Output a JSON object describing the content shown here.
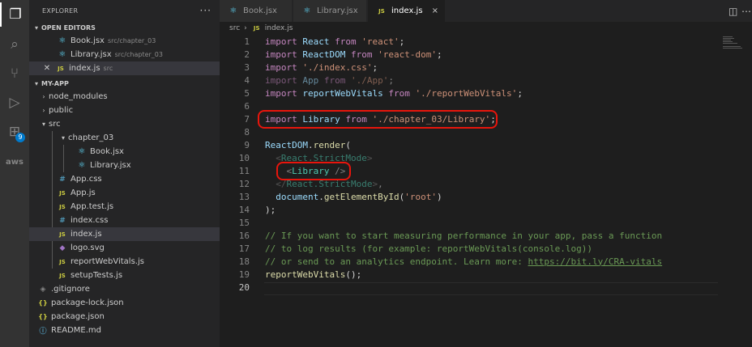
{
  "activity_bar": {
    "icons": [
      "files-icon",
      "search-icon",
      "source-control-icon",
      "run-debug-icon",
      "extensions-icon",
      "aws-icon"
    ],
    "extensions_badge": "9",
    "aws_label": "aws"
  },
  "sidebar": {
    "title": "EXPLORER",
    "more_label": "···",
    "open_editors": {
      "title": "OPEN EDITORS",
      "items": [
        {
          "name": "Book.jsx",
          "desc": "src/chapter_03"
        },
        {
          "name": "Library.jsx",
          "desc": "src/chapter_03"
        },
        {
          "name": "index.js",
          "desc": "src"
        }
      ]
    },
    "project": {
      "title": "MY-APP",
      "tree": [
        {
          "name": "node_modules"
        },
        {
          "name": "public"
        },
        {
          "name": "src"
        },
        {
          "name": "chapter_03"
        },
        {
          "name": "Book.jsx"
        },
        {
          "name": "Library.jsx"
        },
        {
          "name": "App.css"
        },
        {
          "name": "App.js"
        },
        {
          "name": "App.test.js"
        },
        {
          "name": "index.css"
        },
        {
          "name": "index.js"
        },
        {
          "name": "logo.svg"
        },
        {
          "name": "reportWebVitals.js"
        },
        {
          "name": "setupTests.js"
        },
        {
          "name": ".gitignore"
        },
        {
          "name": "package-lock.json"
        },
        {
          "name": "package.json"
        },
        {
          "name": "README.md"
        }
      ]
    }
  },
  "tabs": [
    {
      "label": "Book.jsx"
    },
    {
      "label": "Library.jsx"
    },
    {
      "label": "index.js",
      "close": "×"
    }
  ],
  "breadcrumb": {
    "folder": "src",
    "file": "index.js"
  },
  "editor": {
    "lines": [
      {
        "n": "1"
      },
      {
        "n": "2"
      },
      {
        "n": "3"
      },
      {
        "n": "4"
      },
      {
        "n": "5"
      },
      {
        "n": "6"
      },
      {
        "n": "7"
      },
      {
        "n": "8"
      },
      {
        "n": "9"
      },
      {
        "n": "10"
      },
      {
        "n": "11"
      },
      {
        "n": "12"
      },
      {
        "n": "13"
      },
      {
        "n": "14"
      },
      {
        "n": "15"
      },
      {
        "n": "16"
      },
      {
        "n": "17"
      },
      {
        "n": "18"
      },
      {
        "n": "19"
      },
      {
        "n": "20"
      }
    ],
    "tokens": {
      "import": "import",
      "from": "from",
      "react_id": "React",
      "react_str": "'react'",
      "reactdom_id": "ReactDOM",
      "reactdom_str": "'react-dom'",
      "css_str": "'./index.css'",
      "app_id": "App",
      "app_str": "'./App'",
      "rwv_id": "reportWebVitals",
      "rwv_str": "'./reportWebVitals'",
      "library_id": "Library",
      "library_str": "'./chapter_03/Library'",
      "semi": ";",
      "render_obj": "ReactDOM",
      "render_fn": "render",
      "strict_tag": "React.StrictMode",
      "library_tag": "Library",
      "document": "document",
      "getel_fn": "getElementById",
      "root_str": "'root'",
      "comment1": "// If you want to start measuring performance in your app, pass a function",
      "comment2": "// to log results (for example: reportWebVitals(console.log))",
      "comment3": "// or send to an analytics endpoint. Learn more: ",
      "comment3_url": "https://bit.ly/CRA-vitals",
      "rwv_call": "reportWebVitals"
    }
  },
  "colors": {
    "highlight_ring": "#e8150c",
    "keyword": "#c586c0",
    "variable": "#9cdcfe",
    "string": "#ce9178",
    "comment": "#6a9955",
    "tag": "#4ec9b0",
    "function": "#dcdcaa"
  }
}
